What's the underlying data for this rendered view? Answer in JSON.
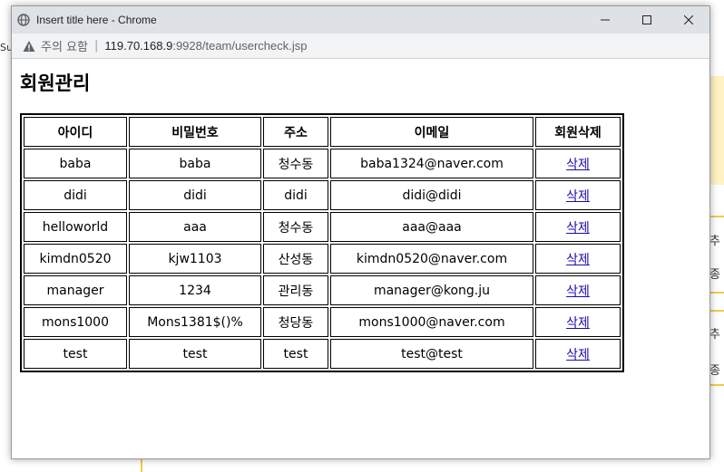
{
  "window": {
    "title": "Insert title here - Chrome",
    "address": {
      "security_label": "주의 요함",
      "url_host": "119.70.168.9",
      "url_path": ":9928/team/usercheck.jsp"
    }
  },
  "page": {
    "title": "회원관리",
    "table": {
      "headers": [
        "아이디",
        "비밀번호",
        "주소",
        "이메일",
        "회원삭제"
      ],
      "rows": [
        {
          "id": "baba",
          "password": "baba",
          "address": "청수동",
          "email": "baba1324@naver.com",
          "action": "삭제"
        },
        {
          "id": "didi",
          "password": "didi",
          "address": "didi",
          "email": "didi@didi",
          "action": "삭제"
        },
        {
          "id": "helloworld",
          "password": "aaa",
          "address": "청수동",
          "email": "aaa@aaa",
          "action": "삭제"
        },
        {
          "id": "kimdn0520",
          "password": "kjw1103",
          "address": "산성동",
          "email": "kimdn0520@naver.com",
          "action": "삭제"
        },
        {
          "id": "manager",
          "password": "1234",
          "address": "관리동",
          "email": "manager@kong.ju",
          "action": "삭제"
        },
        {
          "id": "mons1000",
          "password": "Mons1381$()%",
          "address": "청당동",
          "email": "mons1000@naver.com",
          "action": "삭제"
        },
        {
          "id": "test",
          "password": "test",
          "address": "test",
          "email": "test@test",
          "action": "삭제"
        }
      ]
    }
  },
  "background": {
    "left_fragment": "Suc",
    "right_fragments": [
      "추",
      "종",
      "추",
      "종"
    ]
  },
  "colors": {
    "titlebar": "#dee1e6",
    "link": "#1a0dab",
    "accent_band": "#fff3c4"
  }
}
